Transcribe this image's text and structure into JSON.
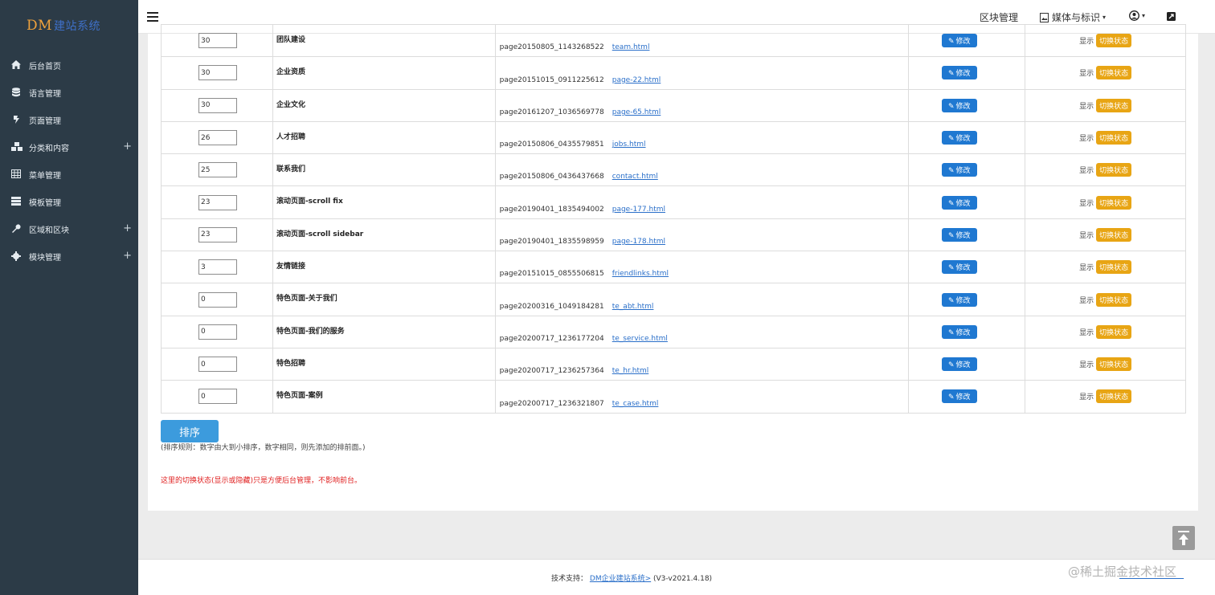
{
  "app": {
    "logo_main": "DM",
    "logo_sub": "建站系统"
  },
  "sidebar": {
    "items": [
      {
        "label": "后台首页",
        "icon": "home-icon",
        "expandable": false
      },
      {
        "label": "语言管理",
        "icon": "database-icon",
        "expandable": false
      },
      {
        "label": "页面管理",
        "icon": "page-icon",
        "expandable": false
      },
      {
        "label": "分类和内容",
        "icon": "cubes-icon",
        "expandable": true
      },
      {
        "label": "菜单管理",
        "icon": "table-icon",
        "expandable": false
      },
      {
        "label": "模板管理",
        "icon": "template-icon",
        "expandable": false
      },
      {
        "label": "区域和区块",
        "icon": "wrench-icon",
        "expandable": true
      },
      {
        "label": "模块管理",
        "icon": "gear-icon",
        "expandable": true
      }
    ],
    "plus_glyph": "+"
  },
  "topbar": {
    "block_manage": "区块管理",
    "media": "媒体与标识",
    "caret": "▾"
  },
  "table": {
    "edit_label": "修改",
    "status_text": "显示",
    "toggle_label": "切换状态",
    "rows": [
      {
        "order": "30",
        "name": "团队建设",
        "page_id": "page20150805_1143268522",
        "file": "team.html"
      },
      {
        "order": "30",
        "name": "企业资质",
        "page_id": "page20151015_0911225612",
        "file": "page-22.html"
      },
      {
        "order": "30",
        "name": "企业文化",
        "page_id": "page20161207_1036569778",
        "file": "page-65.html"
      },
      {
        "order": "26",
        "name": "人才招聘",
        "page_id": "page20150806_0435579851",
        "file": "jobs.html"
      },
      {
        "order": "25",
        "name": "联系我们",
        "page_id": "page20150806_0436437668",
        "file": "contact.html"
      },
      {
        "order": "23",
        "name": "滚动页面-scroll fix",
        "page_id": "page20190401_1835494002",
        "file": "page-177.html"
      },
      {
        "order": "23",
        "name": "滚动页面-scroll sidebar",
        "page_id": "page20190401_1835598959",
        "file": "page-178.html"
      },
      {
        "order": "3",
        "name": "友情链接",
        "page_id": "page20151015_0855506815",
        "file": "friendlinks.html"
      },
      {
        "order": "0",
        "name": "特色页面-关于我们",
        "page_id": "page20200316_1049184281",
        "file": "te_abt.html"
      },
      {
        "order": "0",
        "name": "特色页面-我们的服务",
        "page_id": "page20200717_1236177204",
        "file": "te_service.html"
      },
      {
        "order": "0",
        "name": "特色招聘",
        "page_id": "page20200717_1236257364",
        "file": "te_hr.html"
      },
      {
        "order": "0",
        "name": "特色页面-案例",
        "page_id": "page20200717_1236321807",
        "file": "te_case.html"
      }
    ]
  },
  "sort_button": "排序",
  "rule_note": "(排序规则：数字由大到小排序，数字相同，则先添加的排前面。)",
  "warn_note": "这里的切换状态(显示或隐藏)只是方便后台管理，不影响前台。",
  "footer": {
    "support_label": "技术支持：",
    "link": "DM企业建站系统>",
    "version": "(V3-v2021.4.18)"
  },
  "watermark": "@稀土掘金技术社区",
  "colors": {
    "sidebar_bg": "#2c3b47",
    "edit_blue": "#1f78d1",
    "toggle_amber": "#e8a514",
    "sort_blue": "#3c9bdd",
    "warn_red": "#e02020"
  }
}
